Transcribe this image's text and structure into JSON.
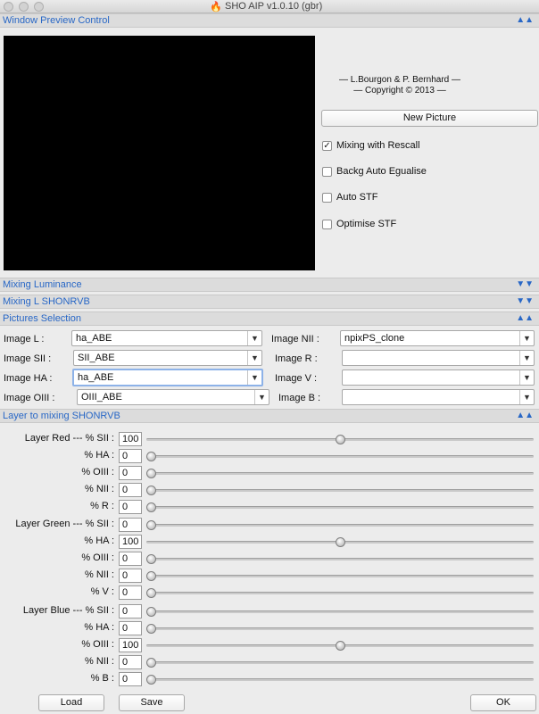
{
  "window": {
    "title": "SHO AIP v1.0.10 (gbr)",
    "icon": "flame-icon"
  },
  "preview": {
    "header": "Window Preview Control",
    "credit_line1": "— L.Bourgon & P. Bernhard —",
    "credit_line2": "— Copyright © 2013 —",
    "new_picture": "New Picture",
    "options": [
      {
        "label": "Mixing with Rescall",
        "checked": true
      },
      {
        "label": "Backg Auto Egualise",
        "checked": false
      },
      {
        "label": "Auto STF",
        "checked": false
      },
      {
        "label": "Optimise STF",
        "checked": false
      }
    ]
  },
  "sections": {
    "mixing_luminance": "Mixing Luminance",
    "mixing_l": "Mixing L SHONRVB",
    "pictures": "Pictures Selection",
    "layers": "Layer to mixing SHONRVB"
  },
  "pictures": {
    "left": [
      {
        "label": "Image L :",
        "value": "ha_ABE"
      },
      {
        "label": "Image  SII :",
        "value": "SII_ABE"
      },
      {
        "label": "Image  HA :",
        "value": "ha_ABE"
      },
      {
        "label": "Image  OIII :",
        "value": "OIII_ABE"
      }
    ],
    "right": [
      {
        "label": "Image  NII :",
        "value": "npixPS_clone"
      },
      {
        "label": "Image   R :",
        "value": ""
      },
      {
        "label": "Image   V :",
        "value": ""
      },
      {
        "label": "Image   B :",
        "value": ""
      }
    ]
  },
  "layers": [
    {
      "label": "Layer Red --- % SII :",
      "value": "100",
      "level": 0.5
    },
    {
      "label": "% HA :",
      "value": "0",
      "level": 0
    },
    {
      "label": "% OIII :",
      "value": "0",
      "level": 0
    },
    {
      "label": "% NII :",
      "value": "0",
      "level": 0
    },
    {
      "label": "% R :",
      "value": "0",
      "level": 0
    },
    {
      "label": "Layer Green --- % SII :",
      "value": "0",
      "level": 0
    },
    {
      "label": "% HA :",
      "value": "100",
      "level": 0.5
    },
    {
      "label": "% OIII :",
      "value": "0",
      "level": 0
    },
    {
      "label": "% NII :",
      "value": "0",
      "level": 0
    },
    {
      "label": "% V :",
      "value": "0",
      "level": 0
    },
    {
      "label": "Layer Blue --- % SII :",
      "value": "0",
      "level": 0
    },
    {
      "label": "% HA :",
      "value": "0",
      "level": 0
    },
    {
      "label": "% OIII :",
      "value": "100",
      "level": 0.5
    },
    {
      "label": "% NII :",
      "value": "0",
      "level": 0
    },
    {
      "label": "% B :",
      "value": "0",
      "level": 0
    }
  ],
  "footer": {
    "load": "Load",
    "save": "Save",
    "ok": "OK"
  }
}
